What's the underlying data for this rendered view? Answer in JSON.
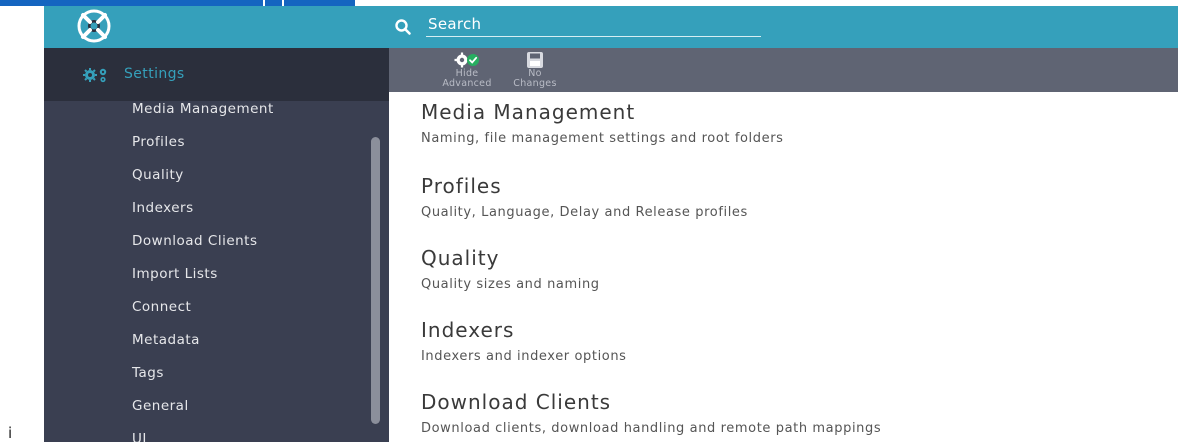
{
  "header": {
    "search_placeholder": "Search",
    "accent_color": "#35a0bb"
  },
  "sidebar": {
    "title": "Settings",
    "items": [
      {
        "label": "Media Management"
      },
      {
        "label": "Profiles"
      },
      {
        "label": "Quality"
      },
      {
        "label": "Indexers"
      },
      {
        "label": "Download Clients"
      },
      {
        "label": "Import Lists"
      },
      {
        "label": "Connect"
      },
      {
        "label": "Metadata"
      },
      {
        "label": "Tags"
      },
      {
        "label": "General"
      },
      {
        "label": "UI"
      }
    ]
  },
  "toolbar": {
    "hide_advanced_line1": "Hide",
    "hide_advanced_line2": "Advanced",
    "no_changes_line1": "No",
    "no_changes_line2": "Changes"
  },
  "sections": [
    {
      "title": "Media Management",
      "description": "Naming, file management settings and root folders"
    },
    {
      "title": "Profiles",
      "description": "Quality, Language, Delay and Release profiles"
    },
    {
      "title": "Quality",
      "description": "Quality sizes and naming"
    },
    {
      "title": "Indexers",
      "description": "Indexers and indexer options"
    },
    {
      "title": "Download Clients",
      "description": "Download clients, download handling and remote path mappings"
    }
  ],
  "stray_text": "i"
}
